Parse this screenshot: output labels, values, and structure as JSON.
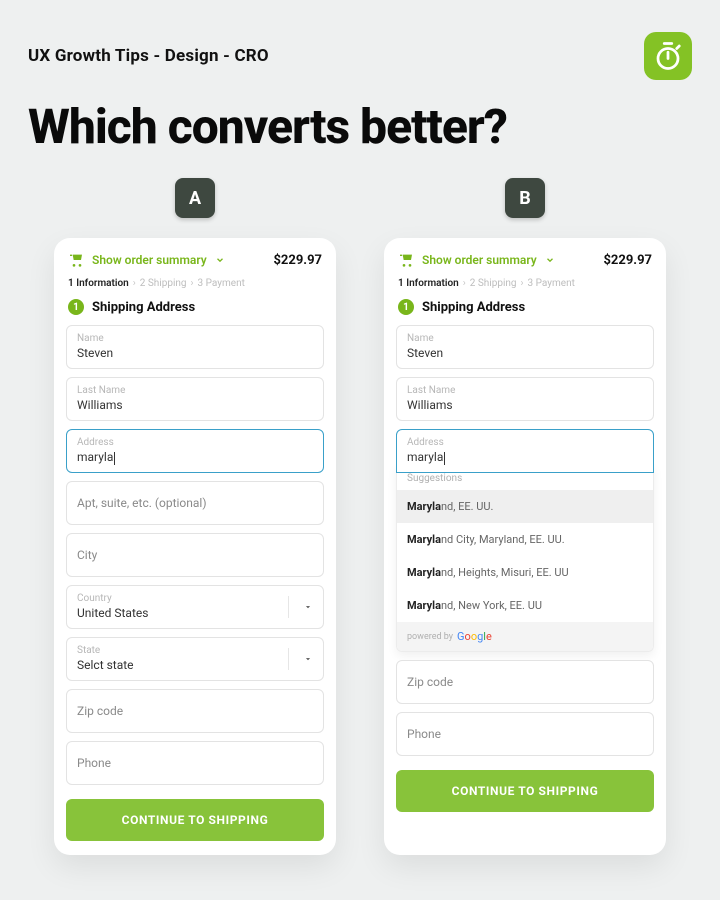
{
  "header": {
    "kicker": "UX Growth Tips - Design - CRO",
    "headline": "Which converts better?"
  },
  "labels": {
    "optionA": "A",
    "optionB": "B"
  },
  "common": {
    "order_summary": "Show order summary",
    "price": "$229.97",
    "crumb1": "1 Information",
    "crumb2": "2 Shipping",
    "crumb3": "3 Payment",
    "step_number": "1",
    "section_title": "Shipping Address",
    "name_label": "Name",
    "name_value": "Steven",
    "lastname_label": "Last Name",
    "lastname_value": "Williams",
    "address_label": "Address",
    "address_value": "maryla",
    "zip_placeholder": "Zip code",
    "phone_placeholder": "Phone",
    "cta": "CONTINUE TO SHIPPING"
  },
  "variantA": {
    "apt_placeholder": "Apt, suite, etc. (optional)",
    "city_placeholder": "City",
    "country_label": "Country",
    "country_value": "United States",
    "state_label": "State",
    "state_value": "Selct state"
  },
  "variantB": {
    "sugg_header": "Suggestions",
    "sugg": [
      {
        "bold": "Maryla",
        "rest": "nd, EE. UU."
      },
      {
        "bold": "Maryla",
        "rest": "nd City, Maryland, EE. UU."
      },
      {
        "bold": "Maryla",
        "rest": "nd, Heights, Misuri, EE. UU"
      },
      {
        "bold": "Maryla",
        "rest": "nd, New York, EE. UU"
      }
    ],
    "powered_by": "powered by"
  },
  "colors": {
    "accent": "#88c33a",
    "focus": "#3aa0c9"
  }
}
